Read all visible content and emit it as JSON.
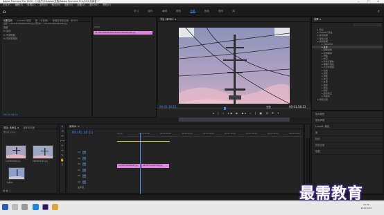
{
  "titlebar": {
    "title": "Adobe Premiere Pro 2020 - C:\\用户\\5\\Adobe\\文档\\Adobe Premiere Pro\\14.0\\未命名 *",
    "controls": "— ☐ ✕"
  },
  "menubar": [
    "文件(F)",
    "编辑(E)",
    "剪辑(C)",
    "序列(S)",
    "标记(M)",
    "图形(G)",
    "视图(V)",
    "窗口(W)",
    "帮助(H)"
  ],
  "workspace_tabs": [
    "学习",
    "组件",
    "编辑",
    "颜色",
    "效果",
    "音频",
    "图形",
    "库"
  ],
  "workspace_active": "效果",
  "effect_controls": {
    "tabs": [
      "效果控件",
      "Lumetri 范围",
      "源：(无剪辑)",
      "音频剪辑混合器：序列01"
    ],
    "source_line": "主要 * 1234567890ABCDEF.jpg ▸ 序列01 * 1234567890ABCDEF.jpg",
    "rows": [
      "视频",
      "fx 运动",
      "fx 不透明度",
      "fx 时间重映射"
    ],
    "timecode": "00:01:18:11"
  },
  "source_monitor": {
    "clip_label": "1234567890ABCDEF1234567890ABCDEF.jpg",
    "time": "00:00"
  },
  "program_monitor": {
    "tab": "节目: 序列01 ≡",
    "timecode_left": "00:01:18:11",
    "fit": "完整",
    "timecode_right": "00:01:58:13",
    "controls": "◂ | ◃ ◂▪ ▶ ▪▸ ▹ | ▣ ⊡ ⌗ +"
  },
  "effects": {
    "tab": "效果 ≡",
    "items": [
      "预设",
      "Lumetri 预设",
      "音频效果",
      "音频过渡",
      "视频效果",
      "Obsolete",
      "变换",
      "图像控制",
      "实用程序",
      "扭曲",
      "时间",
      "杂色与颗粒",
      "模糊与锐化",
      "沉浸式视频",
      "生成",
      "视频",
      "调整",
      "过时",
      "过渡",
      "透视",
      "通道",
      "键控",
      "颜色校正",
      "风格化",
      "视频过渡"
    ],
    "selected_index": 6
  },
  "essentials": [
    "基本图形",
    "基本声音",
    "Lumetri 颜色",
    "库",
    "标记",
    "历史记录",
    "信息"
  ],
  "project": {
    "tabs": [
      "项目: 未命名 ≡",
      "媒体浏览器"
    ],
    "search_placeholder": "未命名.prproj",
    "items": [
      "1234567890.jpg",
      "ABCDEF1234.jpg",
      "序列01"
    ]
  },
  "tools": [
    "▸",
    "⇥",
    "⇔",
    "⟷",
    "✂",
    "↔",
    "✎",
    "✋",
    "T"
  ],
  "timeline": {
    "tab": "序列01 ≡",
    "timecode": "00:01:18:11",
    "ruler": [
      "00:00",
      "00:00:15:00",
      "00:00:30:00",
      "00:00:45:00",
      "00:01:00:00",
      "00:01:15:00",
      "00:01:30:00",
      "00:01:45:00",
      "00:02:00:00"
    ],
    "tracks": [
      "V3",
      "V2",
      "V1",
      "A1",
      "A2",
      "A3",
      "主声道"
    ],
    "clip1": "1234567890ABCDEF.jpg",
    "clip2": "ABCDEF1234567890.jpg"
  },
  "taskbar": {
    "time": "10:26",
    "date": "2021/1/29"
  },
  "watermark": "最需教育"
}
